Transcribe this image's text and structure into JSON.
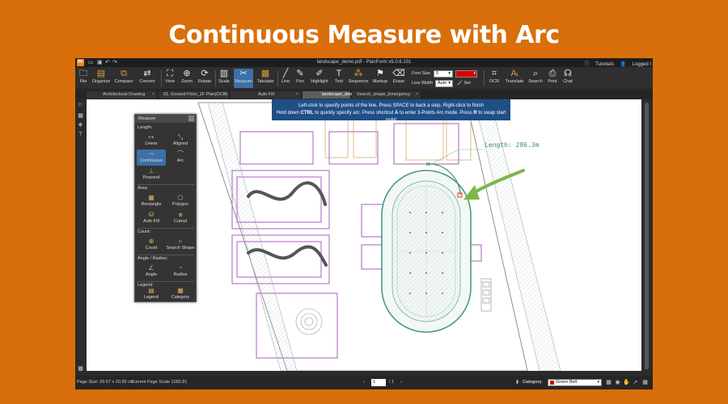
{
  "banner": {
    "title": "Continuous Measure with Arc"
  },
  "app": {
    "logo": "PF",
    "window_title": "landscape_demo.pdf - PlanForm v5.0.6.101",
    "right_links": {
      "tutorials": "Tutorials",
      "logged": "Logged I"
    }
  },
  "toolbar": {
    "file": "File",
    "organize": "Organize",
    "compare": "Compare",
    "convert": "Convert",
    "view": "View",
    "zoom": "Zoom",
    "rotate": "Rotate",
    "scale": "Scale",
    "measure": "Measure",
    "tabulate": "Tabulate",
    "line": "Line",
    "pen": "Pen",
    "highlight": "Highlight",
    "text": "Text",
    "sequence": "Sequence",
    "markup": "Markup",
    "erase": "Erase",
    "font_size_label": "Font Size",
    "font_size_value": "5",
    "line_width_label": "Line Width",
    "line_width_value": "Auto",
    "set": "Set",
    "ocr": "OCR",
    "translate": "Translate",
    "search": "Search",
    "print": "Print",
    "chat": "Chat"
  },
  "tabs": [
    {
      "label": "Architectural Drawing"
    },
    {
      "label": "01. Ground Floor_1F Plan(OCR)"
    },
    {
      "label": "Auto Fill"
    },
    {
      "label": "landscape_demo"
    },
    {
      "label": "Search_shape_Emergency Lighti..."
    }
  ],
  "tooltip": {
    "line1": "Left-click to specify points of the line. Press SPACE to back a step. Right-click to finish",
    "line2_a": "Hold down ",
    "line2_b": "CTRL",
    "line2_c": " to quickly specify arc. Press shortcut ",
    "line2_d": "A",
    "line2_e": " to enter 3-Points Arc mode. Press ",
    "line2_f": "R",
    "line2_g": " to swap start point"
  },
  "panel": {
    "title": "Measure",
    "length": "Length:",
    "linear": "Linear",
    "aligned": "Aligned",
    "continuous": "Continuous",
    "arc": "Arc",
    "perpend": "Perpend",
    "area": "Area:",
    "rectangle": "Rectangle",
    "polygon": "Polygon",
    "autofill": "Auto Fill",
    "cutout": "Cutout",
    "count": "Count:",
    "count_btn": "Count",
    "search_shape": "Search Shape",
    "angle": "Angle / Radius:",
    "angle_btn": "Angle",
    "radius": "Radius",
    "legend": "Legend:",
    "legend_btn": "Legend",
    "category": "Category"
  },
  "drawing": {
    "measure_label": "Length: 286.3m",
    "measure_color": "#3f8f78",
    "arrow_color": "#7bb84a"
  },
  "status": {
    "page_size": "Page Size: 29.67 x 20.99 cm",
    "page_scale": "Current Page Scale 1282.81",
    "page_current": "1",
    "page_total": "/ 1",
    "category_label": "Category",
    "category_value": "Green Belt"
  }
}
